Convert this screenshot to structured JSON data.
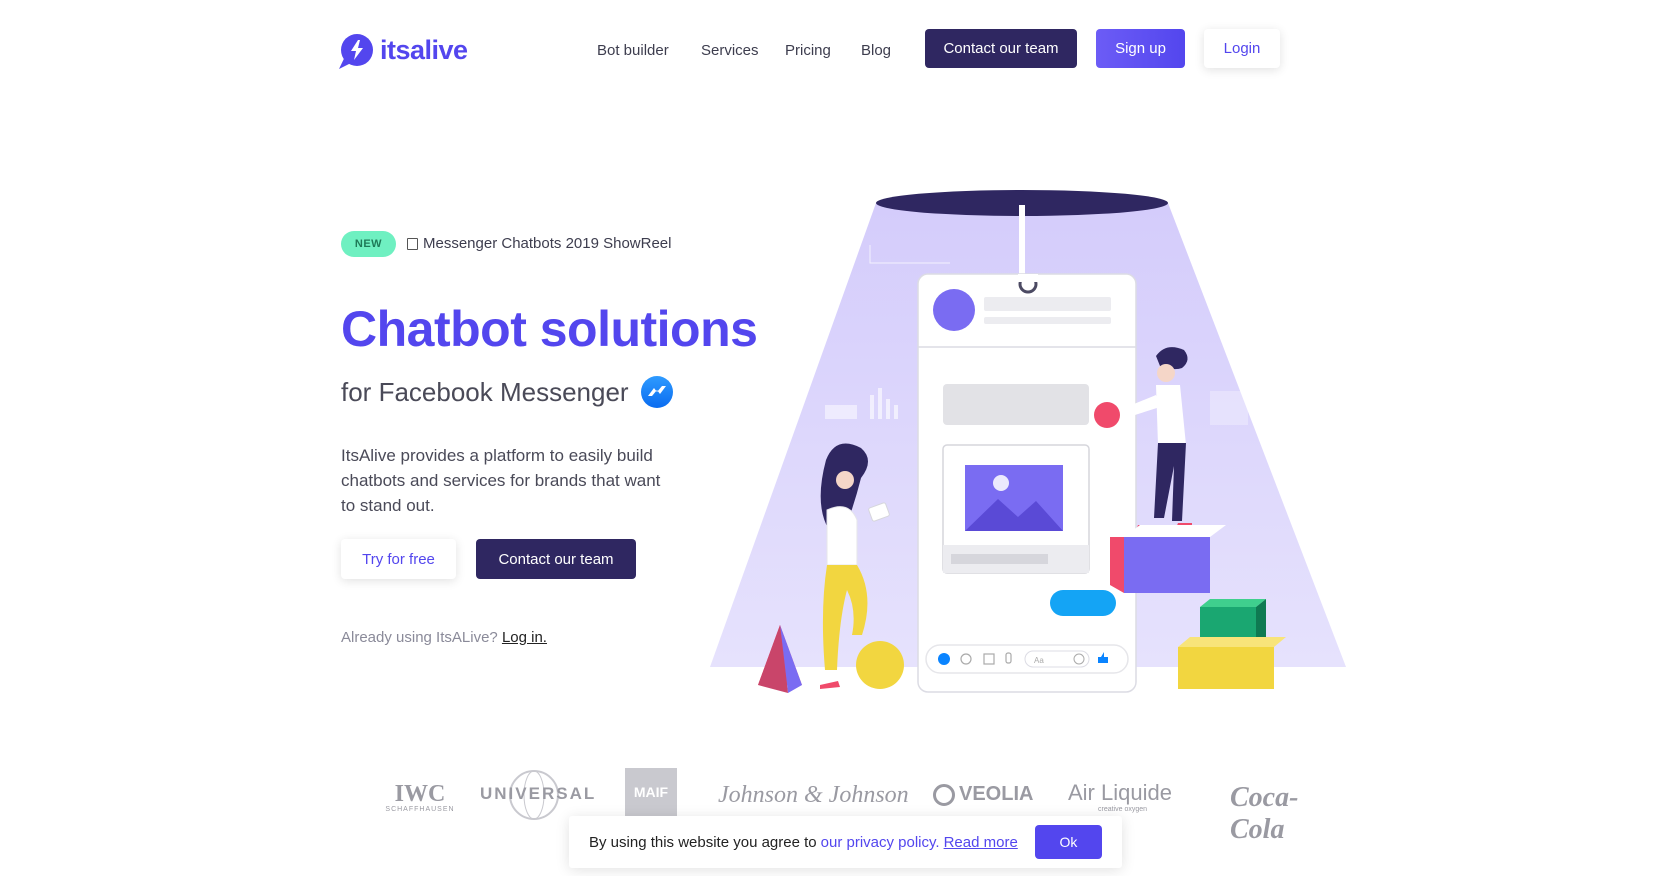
{
  "brand": {
    "name": "itsalive",
    "accent": "#5346ee",
    "dark": "#2f2761"
  },
  "nav": {
    "links": [
      "Bot builder",
      "Services",
      "Pricing",
      "Blog"
    ],
    "contact_label": "Contact our team",
    "signup_label": "Sign up",
    "login_label": "Login"
  },
  "hero": {
    "badge": "NEW",
    "showreel": "Messenger Chatbots 2019 ShowReel",
    "title": "Chatbot solutions",
    "subtitle": "for Facebook Messenger",
    "description": "ItsAlive provides a platform to easily build chatbots and services for brands that want to stand out.",
    "try_label": "Try for free",
    "contact_label": "Contact our team",
    "already_text": "Already using ItsALive?",
    "login_link": "Log in."
  },
  "illustration": {
    "input_placeholder": "Aa"
  },
  "brands": [
    "IWC",
    "SCHAFFHAUSEN",
    "UNIVERSAL",
    "MAIF",
    "Johnson & Johnson",
    "VEOLIA",
    "Air Liquide",
    "creative oxygen",
    "Coca-Cola"
  ],
  "cookie": {
    "text": "By using this website you agree to",
    "privacy_link": "our privacy policy.",
    "read_more": "Read more",
    "ok_label": "Ok"
  }
}
